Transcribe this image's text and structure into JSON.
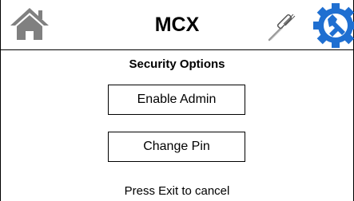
{
  "header": {
    "title": "MCX",
    "home_icon": "home-icon",
    "tools_icon": "screwdriver-icon",
    "settings_icon": "gear-wrench-icon",
    "settings_color": "#1f6fd1",
    "home_color": "#808080"
  },
  "main": {
    "section_title": "Security Options",
    "buttons": [
      {
        "label": "Enable Admin"
      },
      {
        "label": "Change Pin"
      }
    ],
    "footer_text": "Press Exit to cancel"
  }
}
